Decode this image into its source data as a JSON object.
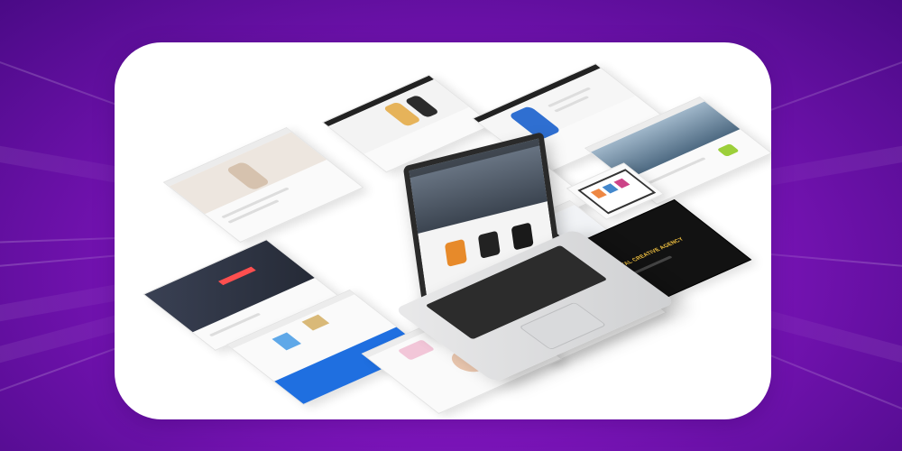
{
  "banner": {
    "background_color": "#7a14b8",
    "card_color": "#ffffff"
  },
  "tiles": [
    {
      "name": "fashion-store-tile",
      "hero_text": "",
      "accent": "#e8e1da"
    },
    {
      "name": "clothing-shop-tile",
      "hero_text": "",
      "accent": "#dccfe0"
    },
    {
      "name": "landscape-tile",
      "hero_text": "",
      "accent": "#5f7c93"
    },
    {
      "name": "mockup-tile",
      "hero_text": "",
      "accent": "#2a80ff"
    },
    {
      "name": "creative-agency-tile",
      "hero_text": "DIGITAL CREATIVE AGENCY",
      "accent": "#111111"
    },
    {
      "name": "portfolio-dark-tile",
      "hero_text": "",
      "accent": "#2e3342"
    },
    {
      "name": "product-grid-tile",
      "hero_text": "",
      "accent": "#ff6b6b"
    },
    {
      "name": "laptop-showcase-tile",
      "hero_text": "",
      "accent": "#e6e6e6"
    },
    {
      "name": "blue-brand-tile",
      "hero_text": "",
      "accent": "#1f6fe0"
    },
    {
      "name": "yoga-tile",
      "hero_text": "",
      "accent": "#f2c6d8"
    }
  ],
  "laptop": {
    "screen_caption": "",
    "screen_colors": [
      "#e78a2a",
      "#222222",
      "#1a1a1a"
    ]
  }
}
